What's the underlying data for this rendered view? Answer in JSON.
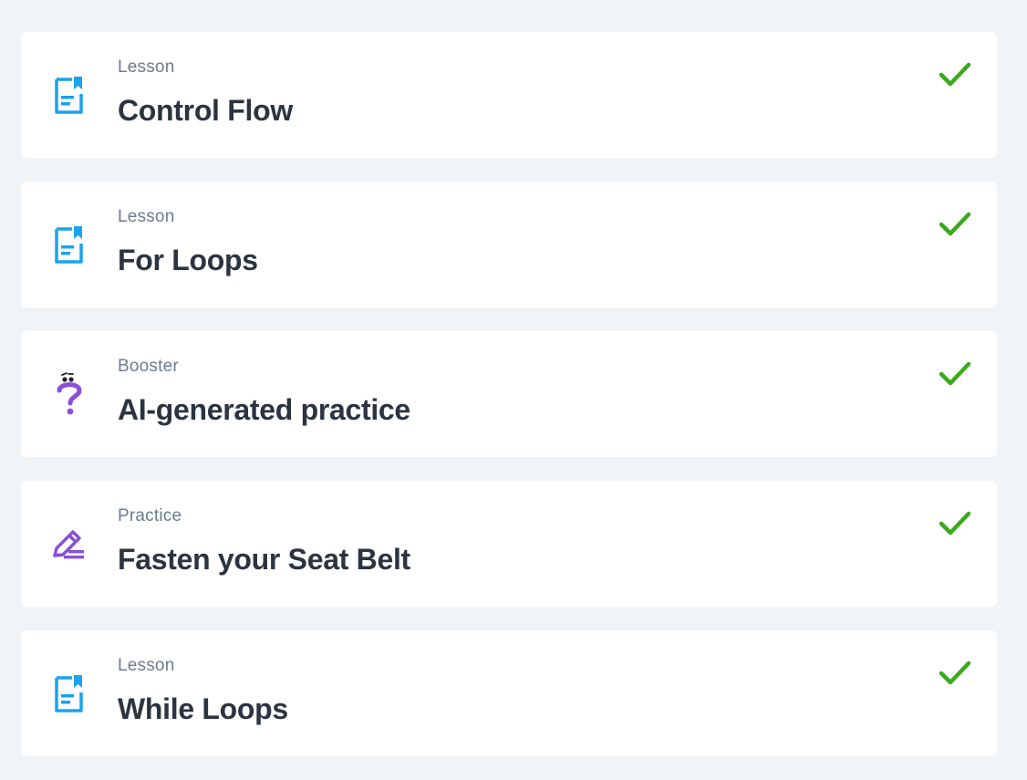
{
  "colors": {
    "background": "#f1f4f7",
    "card": "#ffffff",
    "lesson_icon": "#1aa3ee",
    "booster_icon": "#8a4fd6",
    "practice_icon": "#8a4fd6",
    "check": "#3aaa1c",
    "kind_text": "#6b7b8f",
    "title_text": "#2b3440"
  },
  "items": [
    {
      "kind": "Lesson",
      "title": "Control Flow",
      "icon": "lesson-icon",
      "completed": true
    },
    {
      "kind": "Lesson",
      "title": "For Loops",
      "icon": "lesson-icon",
      "completed": true
    },
    {
      "kind": "Booster",
      "title": "AI-generated practice",
      "icon": "booster-question-icon",
      "completed": true
    },
    {
      "kind": "Practice",
      "title": "Fasten your Seat Belt",
      "icon": "practice-pencil-icon",
      "completed": true
    },
    {
      "kind": "Lesson",
      "title": "While Loops",
      "icon": "lesson-icon",
      "completed": true
    }
  ]
}
